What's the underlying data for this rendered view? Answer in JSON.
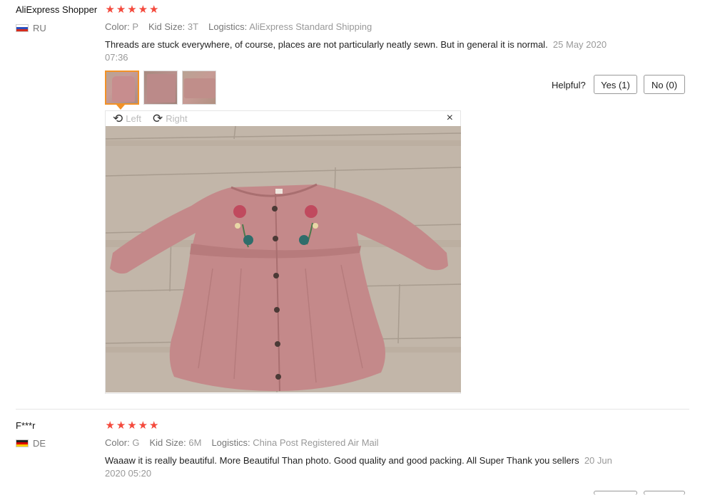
{
  "reviews": [
    {
      "user": "AliExpress Shopper",
      "country": "RU",
      "stars": 5,
      "attributes": [
        {
          "label": "Color:",
          "value": "P"
        },
        {
          "label": "Kid Size:",
          "value": "3T"
        },
        {
          "label": "Logistics:",
          "value": "AliExpress Standard Shipping"
        }
      ],
      "text": "Threads are stuck everywhere, of course, places are not particularly neatly sewn. But in general it is normal.",
      "date": "25 May 2020 07:36",
      "helpful_label": "Helpful?",
      "yes_label": "Yes (1)",
      "no_label": "No (0)",
      "viewer": {
        "rotate_left": "Left",
        "rotate_right": "Right",
        "close": "×"
      }
    },
    {
      "user": "F***r",
      "country": "DE",
      "stars": 5,
      "attributes": [
        {
          "label": "Color:",
          "value": "G"
        },
        {
          "label": "Kid Size:",
          "value": "6M"
        },
        {
          "label": "Logistics:",
          "value": "China Post Registered Air Mail"
        }
      ],
      "text": "Waaaw it is really beautiful. More Beautiful Than photo. Good quality and good packing. All Super Thank you sellers",
      "date": "20 Jun 2020 05:20"
    }
  ],
  "icons": {
    "star": "★",
    "rotate_left": "rotate-left-icon",
    "rotate_right": "rotate-right-icon",
    "close": "close-icon"
  },
  "colors": {
    "star": "#f4493c",
    "thumb_active": "#f29227",
    "dress": "#c4898a",
    "floor": "#bfb3a6"
  }
}
